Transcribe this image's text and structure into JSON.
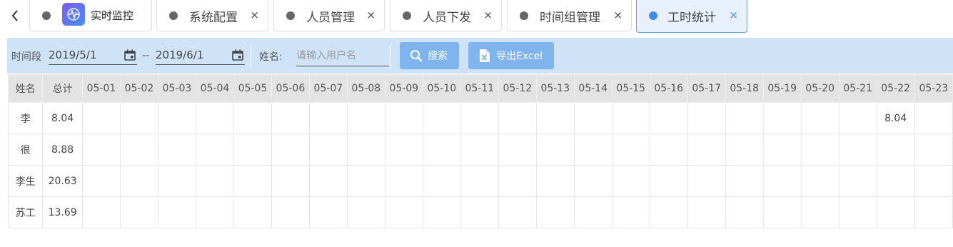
{
  "tabs": [
    {
      "label": "实时监控",
      "closable": false,
      "active": false
    },
    {
      "label": "系统配置",
      "closable": true,
      "active": false
    },
    {
      "label": "人员管理",
      "closable": true,
      "active": false
    },
    {
      "label": "人员下发",
      "closable": true,
      "active": false
    },
    {
      "label": "时间组管理",
      "closable": true,
      "active": false
    },
    {
      "label": "工时统计",
      "closable": true,
      "active": true
    }
  ],
  "close_glyph": "×",
  "toolbar": {
    "period_label": "时间段",
    "start_date": "2019/5/1",
    "range_sep": "--",
    "end_date": "2019/6/1",
    "name_label": "姓名:",
    "name_placeholder": "请输入用户名",
    "search_label": "搜索",
    "export_label": "导出Excel"
  },
  "table": {
    "headers": [
      "姓名",
      "总计",
      "05-01",
      "05-02",
      "05-03",
      "05-04",
      "05-05",
      "05-06",
      "05-07",
      "05-08",
      "05-09",
      "05-10",
      "05-11",
      "05-12",
      "05-13",
      "05-14",
      "05-15",
      "05-16",
      "05-17",
      "05-18",
      "05-19",
      "05-20",
      "05-21",
      "05-22",
      "05-23"
    ],
    "rows": [
      {
        "name": "李",
        "total": "8.04",
        "days": {
          "05-22": "8.04"
        }
      },
      {
        "name": "很",
        "total": "8.88",
        "days": {}
      },
      {
        "name": "李生",
        "total": "20.63",
        "days": {}
      },
      {
        "name": "苏工",
        "total": "13.69",
        "days": {}
      }
    ]
  },
  "colors": {
    "accent": "#3b8ce8",
    "toolbar_bg": "#cfe3f8",
    "button_bg": "#7fb4ee",
    "header_bg": "#e3e3e3"
  }
}
